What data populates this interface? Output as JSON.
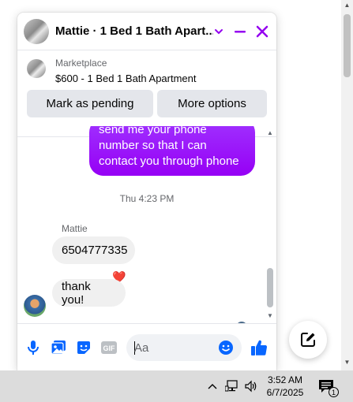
{
  "chat": {
    "title": "Mattie · 1 Bed 1 Bath Apart...",
    "marketplace_label": "Marketplace",
    "listing_title": "$600 - 1 Bed 1 Bath Apartment",
    "actions": {
      "pending": "Mark as pending",
      "more": "More options"
    }
  },
  "messages": {
    "outgoing_text": "send me your phone number so that I can contact you through phone",
    "timestamp": "Thu 4:23 PM",
    "sender_name": "Mattie",
    "incoming_1": "6504777335",
    "reaction": "❤️",
    "incoming_2": "thank you!"
  },
  "composer": {
    "placeholder": "Aa"
  },
  "taskbar": {
    "time": "3:52 AM",
    "date": "6/7/2025",
    "notification_count": "1"
  },
  "colors": {
    "accent": "#a033ff",
    "brand": "#0866ff"
  }
}
